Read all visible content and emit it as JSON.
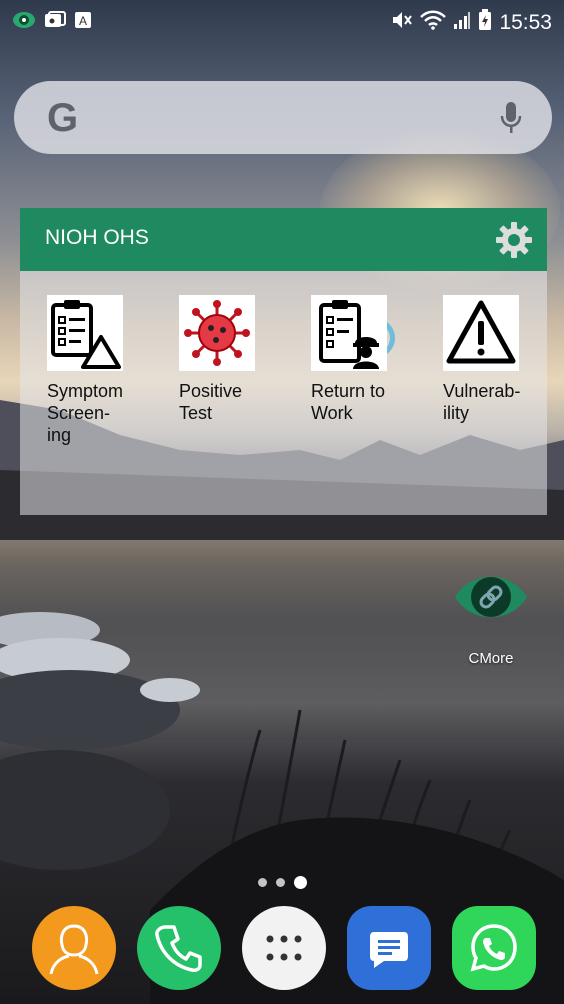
{
  "status_bar": {
    "time": "15:53",
    "left_icons": [
      "eye-app-icon",
      "photo-notification-icon",
      "a-notification-icon"
    ],
    "right_icons": [
      "mute-icon",
      "wifi-icon",
      "signal-icon",
      "battery-charging-icon"
    ]
  },
  "search": {
    "logo": "G",
    "icons": [
      "google-logo",
      "mic-icon"
    ]
  },
  "widget": {
    "title": "NIOH OHS",
    "header_color": "#1f8a5f",
    "tiles": [
      {
        "label": "Symptom Screen-ing",
        "line1": "Symptom",
        "line2": "Screen-",
        "line3": "ing",
        "icon": "clipboard-warning-icon"
      },
      {
        "label": "Positive Test",
        "line1": "Positive",
        "line2": "Test",
        "line3": "",
        "icon": "virus-icon"
      },
      {
        "label": "Return to Work",
        "line1": "Return to",
        "line2": "Work",
        "line3": "",
        "icon": "clipboard-worker-icon"
      },
      {
        "label": "Vulnerab-ility",
        "line1": "Vulnerab-",
        "line2": "ility",
        "line3": "",
        "icon": "warning-triangle-icon"
      }
    ]
  },
  "desktop_app": {
    "label": "CMore",
    "icon": "cmore-eye-icon",
    "color": "#1f8a5f"
  },
  "page_indicator": {
    "count": 3,
    "active_index": 2
  },
  "dock": [
    {
      "name": "contacts",
      "icon": "contacts-icon",
      "color": "#f39a1e"
    },
    {
      "name": "phone",
      "icon": "phone-icon",
      "color": "#25c06a"
    },
    {
      "name": "apps",
      "icon": "app-drawer-icon",
      "color": "#f2f2f2"
    },
    {
      "name": "messages",
      "icon": "messages-icon",
      "color": "#2f6fd8"
    },
    {
      "name": "whatsapp",
      "icon": "whatsapp-icon",
      "color": "#2fd65a"
    }
  ]
}
